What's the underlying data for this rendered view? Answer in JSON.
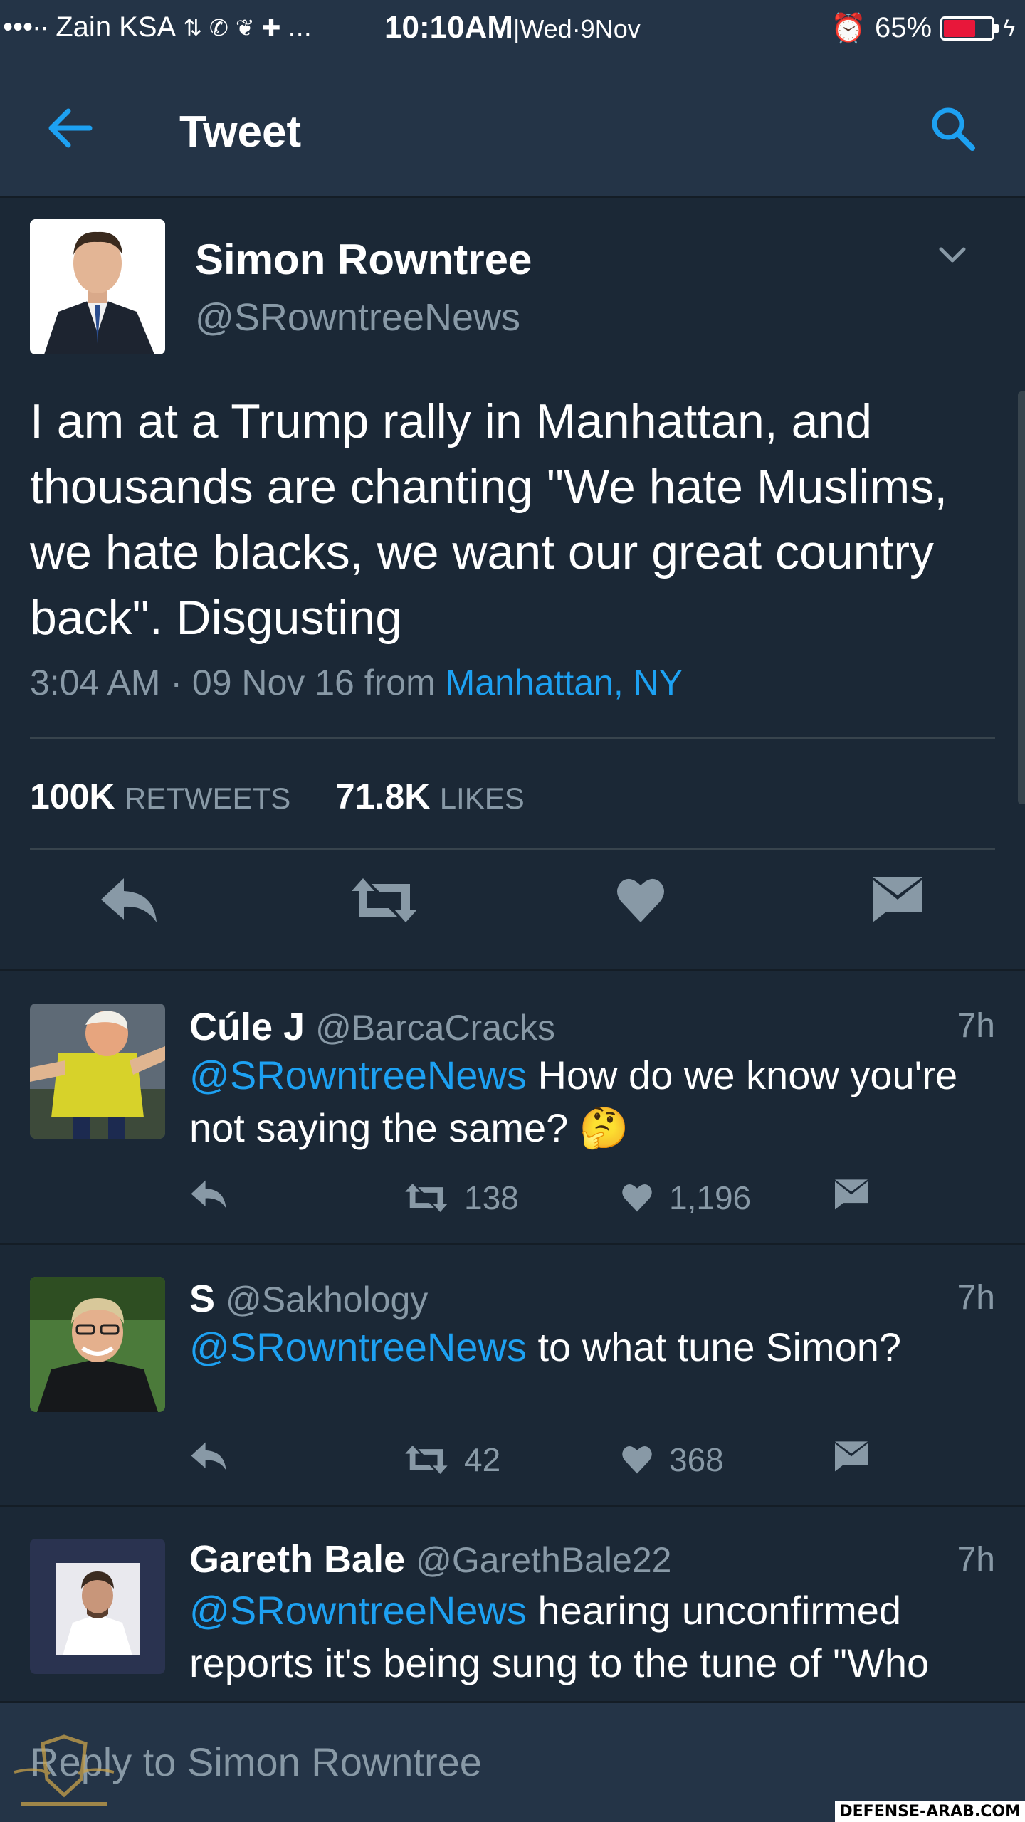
{
  "status_bar": {
    "carrier": "Zain KSA",
    "more": "...",
    "time": "10:10AM",
    "date": "|Wed·9Nov",
    "battery": "65%"
  },
  "header": {
    "title": "Tweet"
  },
  "main_tweet": {
    "name": "Simon Rowntree",
    "handle": "@SRowntreeNews",
    "text": "I am at a Trump rally in Manhattan, and thousands are chanting \"We hate Muslims, we hate blacks, we want our great country back\". Disgusting",
    "timestamp": "3:04 AM · 09 Nov 16",
    "from_label": "from",
    "location": "Manhattan, NY",
    "retweets_count": "100K",
    "retweets_label": "RETWEETS",
    "likes_count": "71.8K",
    "likes_label": "LIKES"
  },
  "replies": [
    {
      "name": "Cúle J",
      "handle": "@BarcaCracks",
      "time": "7h",
      "mention": "@SRowntreeNews",
      "text": " How do we know you're not saying the same? 🤔",
      "retweets": "138",
      "likes": "1,196"
    },
    {
      "name": "S",
      "handle": "@Sakhology",
      "time": "7h",
      "mention": "@SRowntreeNews",
      "text": " to what tune Simon?",
      "retweets": "42",
      "likes": "368"
    },
    {
      "name": "Gareth Bale",
      "handle": "@GarethBale22",
      "time": "7h",
      "mention": "@SRowntreeNews",
      "text": " hearing unconfirmed reports it's being sung to the tune of \"Who",
      "retweets": "",
      "likes": ""
    }
  ],
  "compose": {
    "placeholder": "Reply to Simon Rowntree"
  },
  "watermark": {
    "site": "DEFENSE-ARAB.COM"
  },
  "colors": {
    "background": "#1b2836",
    "bar": "#243447",
    "link": "#1da1f2",
    "muted": "#8899a6"
  }
}
